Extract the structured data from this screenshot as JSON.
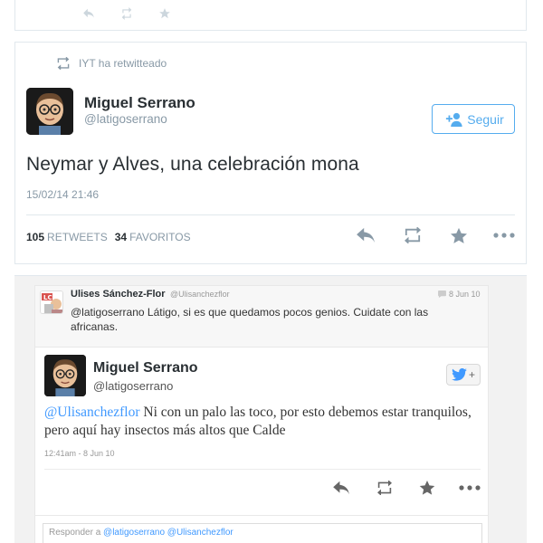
{
  "top_stub": {
    "icons": [
      "reply-icon",
      "retweet-icon",
      "favorite-icon"
    ]
  },
  "main_tweet": {
    "retweet_context": "IYT ha retwitteado",
    "author": {
      "name": "Miguel Serrano",
      "handle": "@latigoserrano"
    },
    "follow_label": "Seguir",
    "text": "Neymar y Alves, una celebración mona",
    "timestamp": "15/02/14 21:46",
    "stats": {
      "retweets_count": "105",
      "retweets_label": "RETWEETS",
      "favorites_count": "34",
      "favorites_label": "FAVORITOS"
    },
    "accent_color": "#55acee"
  },
  "embedded": {
    "in_reply_to": {
      "name": "Ulises Sánchez-Flor",
      "handle": "@Ulisanchezflor",
      "date": "8 Jun 10",
      "text": "@latigoserrano Látigo, si es que quedamos pocos genios. Cuidate con las africanas."
    },
    "tweet": {
      "name": "Miguel Serrano",
      "handle": "@latigoserrano",
      "follow_label": "+",
      "mention": "@Ulisanchezflor",
      "text": " Ni con un palo las toco, por esto debemos estar tranquilos, pero aquí hay insectos más altos que Calde",
      "timestamp": "12:41am - 8 Jun 10"
    },
    "reply_box": {
      "prefix": "Responder a",
      "mentions": "@latigoserrano @Ulisanchezflor"
    },
    "link_color": "#4099ff"
  }
}
